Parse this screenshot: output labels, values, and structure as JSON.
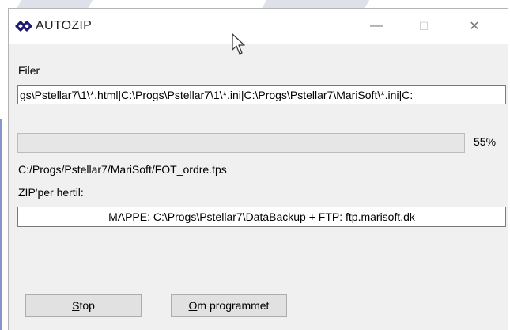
{
  "window": {
    "title": "AUTOZIP",
    "controls": {
      "minimize": "—",
      "maximize": "☐",
      "close": "✕"
    }
  },
  "files": {
    "label": "Filer",
    "value": "gs\\Pstellar7\\1\\*.html|C:\\Progs\\Pstellar7\\1\\*.ini|C:\\Progs\\Pstellar7\\MariSoft\\*.ini|C:"
  },
  "progress": {
    "percent": 55,
    "label": "55%",
    "current_file": "C:/Progs/Pstellar7/MariSoft/FOT_ordre.tps"
  },
  "target": {
    "label": "ZIP'per  hertil:",
    "value": "MAPPE: C:\\Progs\\Pstellar7\\DataBackup + FTP: ftp.marisoft.dk"
  },
  "buttons": {
    "stop": {
      "accel": "S",
      "rest": "top"
    },
    "about": {
      "accel": "O",
      "rest": "m programmet"
    }
  },
  "colors": {
    "accent": "#1d1a6b",
    "window_bg": "#f0f0f0",
    "button_bg": "#e1e1e1"
  }
}
